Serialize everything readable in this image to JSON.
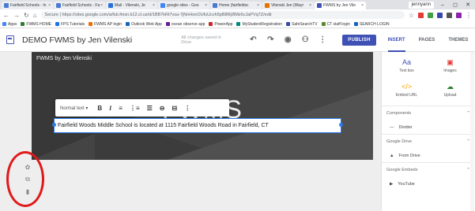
{
  "browser": {
    "tabs": [
      {
        "label": "Fairfield Schools - In",
        "color": "#4a7bd1",
        "active": false
      },
      {
        "label": "Fairfield Schools - Fa",
        "color": "#4a7bd1",
        "active": false
      },
      {
        "label": "Mail - Vilenski, Je",
        "color": "#2a6fdb",
        "active": false
      },
      {
        "label": "google sites - Goo",
        "color": "#4285f4",
        "active": false
      },
      {
        "label": "Home (fairfieldsc",
        "color": "#4a7bd1",
        "active": false
      },
      {
        "label": "Vilenski Jen (Wayr",
        "color": "#e37400",
        "active": false
      },
      {
        "label": "FWMS by Jen Vile",
        "color": "#3f51b5",
        "active": true
      }
    ],
    "user": "jennyann",
    "window_controls": [
      "–",
      "◻",
      "✕"
    ],
    "url": "Secure | https://sites.google.com/a/fsb.fmsn.k12.ct.us/d/1BB7kRt7vsa-7jNnHooOUfuUcvh5pB8Rj/8Mz6cJaPVq7Z/edit",
    "bookmarks": [
      {
        "label": "Apps",
        "color": "#4285f4"
      },
      {
        "label": "FWMS HOME",
        "color": "#2e7d32"
      },
      {
        "label": "FPS Tutorials",
        "color": "#1a73e8"
      },
      {
        "label": "FWMS AP login",
        "color": "#ef6c00"
      },
      {
        "label": "Outlook Web App",
        "color": "#1565c0"
      },
      {
        "label": "ocean observe app",
        "color": "#6a1b9a"
      },
      {
        "label": "PowerApp",
        "color": "#c62828"
      },
      {
        "label": "MyStudentRegistration",
        "color": "#00897b"
      },
      {
        "label": "SafeSearchTV",
        "color": "#3949ab"
      },
      {
        "label": "CT staff login",
        "color": "#558b2f"
      },
      {
        "label": "SEARCH LOGIN",
        "color": "#1565c0"
      }
    ]
  },
  "appbar": {
    "title": "DEMO FWMS by Jen Vilenski",
    "saved_status": "All changes saved in Drive",
    "publish_label": "PUBLISH"
  },
  "side_tabs": [
    "INSERT",
    "PAGES",
    "THEMES"
  ],
  "hero": {
    "site_name": "FWMS by Jen Vilenski",
    "title": "FWMS"
  },
  "format_bar": {
    "style_label": "Normal text ▾",
    "buttons": [
      "B",
      "I",
      "≡",
      "⋮≡",
      "☰",
      "⊖",
      "⊟",
      "⋮"
    ]
  },
  "textbox": {
    "text": "Fairfield Woods Middle School is located at 1115 Fairfield Woods Road in Fairfield, CT"
  },
  "insert_panel": {
    "items": [
      {
        "label": "Text box",
        "icon": "Aa",
        "color": "#3f51b5"
      },
      {
        "label": "Images",
        "icon": "▣",
        "color": "#e53935"
      },
      {
        "label": "Embed URL",
        "icon": "</>",
        "color": "#f4a300"
      },
      {
        "label": "Upload",
        "icon": "☁",
        "color": "#2e7d32"
      }
    ],
    "sections": [
      {
        "label": "Components",
        "sub": [
          {
            "icon": "—",
            "label": "Divider"
          }
        ]
      },
      {
        "label": "Google Drive",
        "sub": [
          {
            "icon": "▲",
            "label": "From Drive"
          }
        ]
      },
      {
        "label": "Google Embeds",
        "sub": [
          {
            "icon": "▶",
            "label": "YouTube"
          }
        ]
      }
    ]
  }
}
